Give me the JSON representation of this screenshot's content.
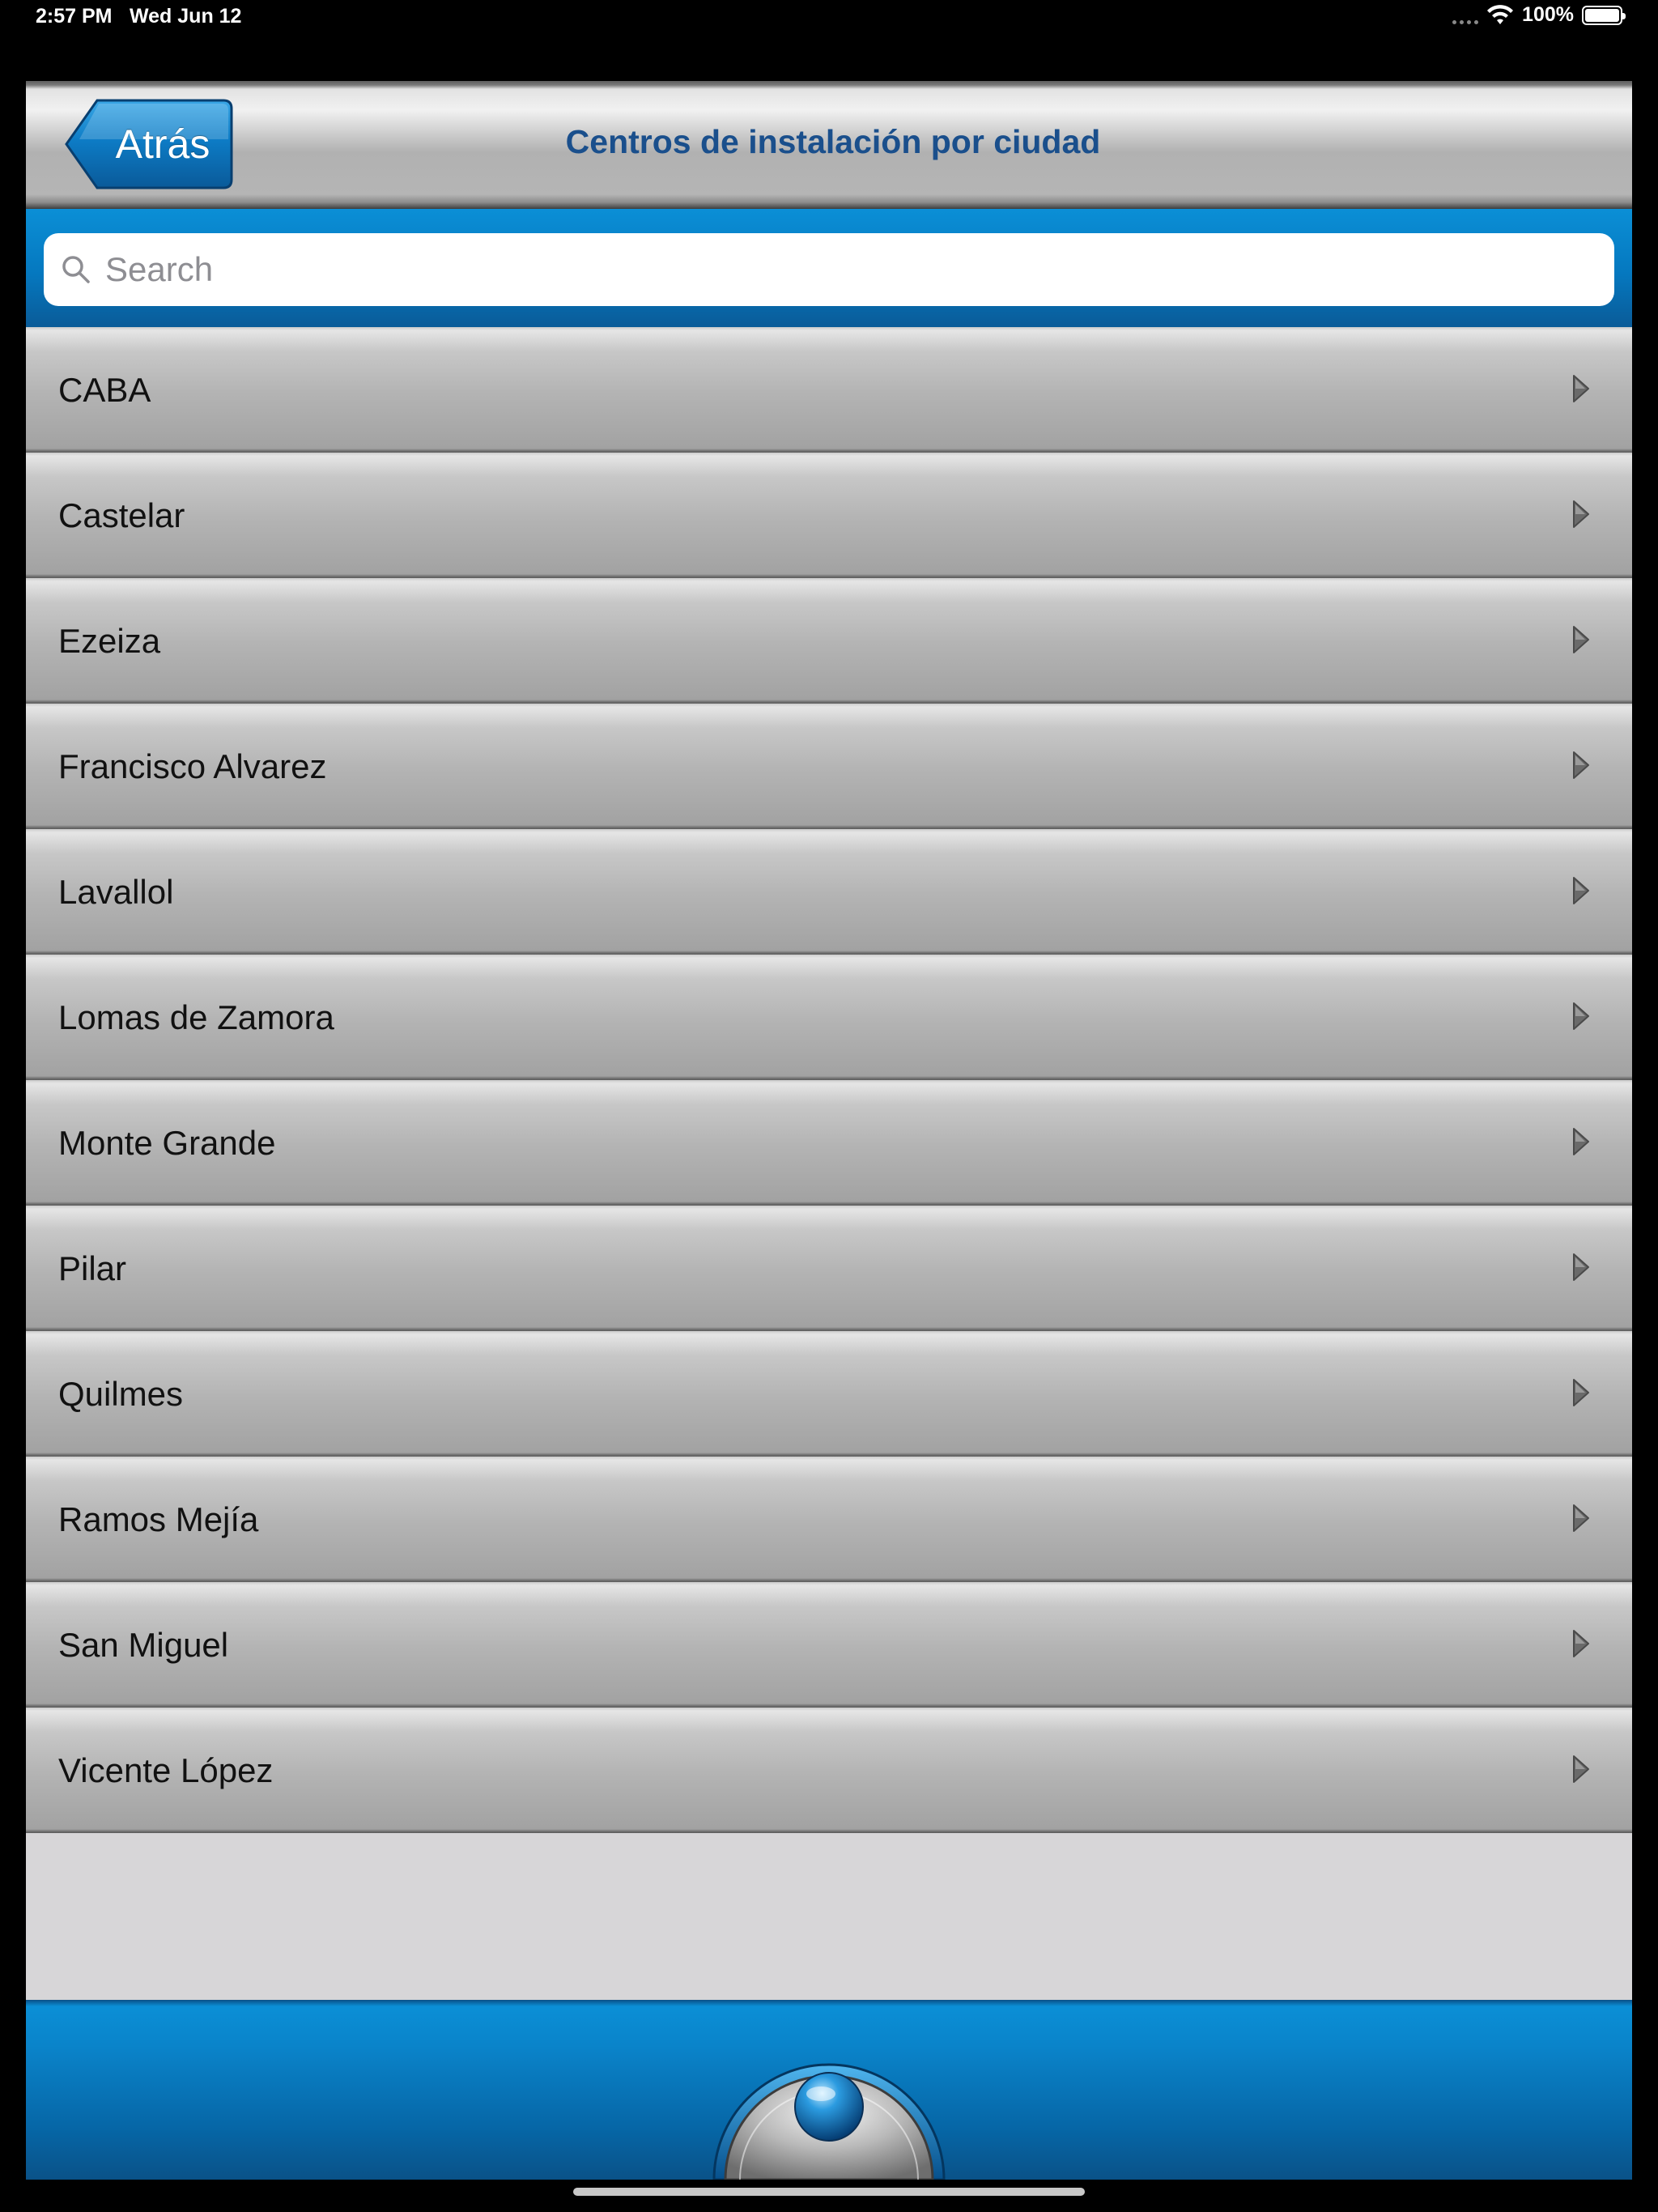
{
  "status_bar": {
    "time": "2:57 PM",
    "date": "Wed Jun 12",
    "battery": "100%"
  },
  "nav": {
    "back_label": "Atrás",
    "title": "Centros de instalación por ciudad"
  },
  "search": {
    "placeholder": "Search"
  },
  "cities": [
    "CABA",
    "Castelar",
    "Ezeiza",
    "Francisco Alvarez",
    "Lavallol",
    "Lomas de Zamora",
    "Monte Grande",
    "Pilar",
    "Quilmes",
    "Ramos Mejía",
    "San Miguel",
    "Vicente López"
  ],
  "colors": {
    "accent_blue": "#0578bf",
    "title_blue": "#1a4f8c"
  },
  "icons": {
    "back": "back-arrow-button",
    "search": "search-icon",
    "row_chevron": "chevron-right-icon",
    "home": "home-knob-button"
  }
}
